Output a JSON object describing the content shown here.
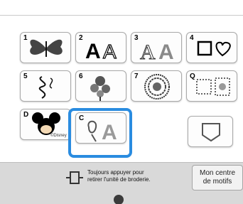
{
  "categories": [
    {
      "number": "1",
      "name": "butterfly",
      "interactable": true
    },
    {
      "number": "2",
      "name": "font-aa",
      "interactable": true
    },
    {
      "number": "3",
      "name": "outline-aa",
      "interactable": true
    },
    {
      "number": "4",
      "name": "frames",
      "interactable": true
    },
    {
      "number": "5",
      "name": "ornament",
      "interactable": true
    },
    {
      "number": "6",
      "name": "flowers",
      "interactable": true
    },
    {
      "number": "7",
      "name": "mandala",
      "interactable": true
    },
    {
      "number": "Q",
      "name": "quilt",
      "interactable": true
    },
    {
      "number": "D",
      "name": "mickey",
      "interactable": true
    },
    {
      "number": "C",
      "name": "rose-a",
      "interactable": true,
      "selected": true
    }
  ],
  "disney_mark": "©Disney",
  "footer": {
    "hint_line1": "Toujours appuyer pour",
    "hint_line2": "retirer l'unité de broderie.",
    "pattern_button_line1": "Mon centre",
    "pattern_button_line2": "de motifs"
  },
  "colors": {
    "accent": "#2a8ce0",
    "footer": "#d9d9d9"
  }
}
